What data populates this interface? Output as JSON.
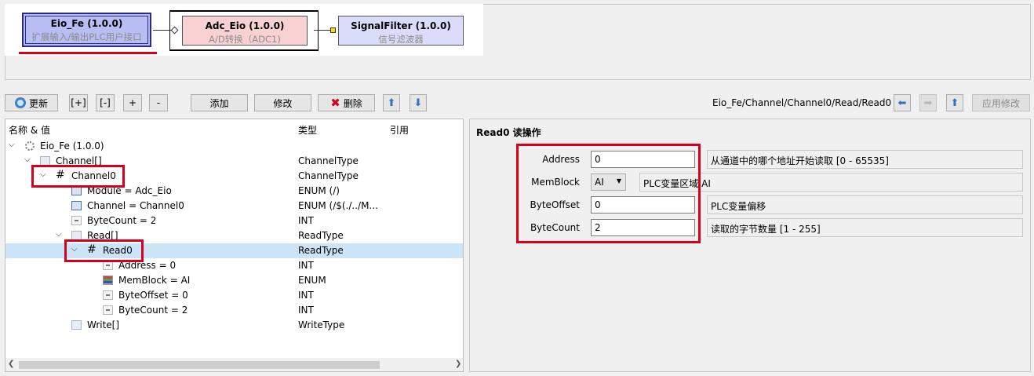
{
  "diagram": {
    "blocks": [
      {
        "title": "Eio_Fe (1.0.0)",
        "subtitle": "扩展输入/输出PLC用户接口"
      },
      {
        "title": "Adc_Eio (1.0.0)",
        "subtitle": "A/D转换（ADC1)"
      },
      {
        "title": "SignalFilter (1.0.0)",
        "subtitle": "信号滤波器"
      }
    ]
  },
  "toolbar": {
    "refresh": "更新",
    "expand": "[+]",
    "collapse": "[-]",
    "plus": "+",
    "minus": "-",
    "add": "添加",
    "modify": "修改",
    "delete": "删除",
    "path": "Eio_Fe/Channel/Channel0/Read/Read0",
    "apply": "应用修改",
    "icons": {
      "up": "arrow-up-icon",
      "down": "arrow-down-icon",
      "back": "arrow-left-icon",
      "forward": "arrow-right-icon"
    }
  },
  "tree": {
    "headers": {
      "name": "名称 & 值",
      "type": "类型",
      "ref": "引用"
    },
    "rows": [
      {
        "label": "Eio_Fe (1.0.0)",
        "type": ""
      },
      {
        "label": "Channel[]",
        "type": "ChannelType"
      },
      {
        "label": "Channel0",
        "type": "ChannelType"
      },
      {
        "label": "Module = Adc_Eio",
        "type": "ENUM (/)"
      },
      {
        "label": "Channel = Channel0",
        "type": "ENUM (/$(./../M..."
      },
      {
        "label": "ByteCount = 2",
        "type": "INT"
      },
      {
        "label": "Read[]",
        "type": "ReadType"
      },
      {
        "label": "Read0",
        "type": "ReadType"
      },
      {
        "label": "Address = 0",
        "type": "INT"
      },
      {
        "label": "MemBlock = AI",
        "type": "ENUM"
      },
      {
        "label": "ByteOffset = 0",
        "type": "INT"
      },
      {
        "label": "ByteCount = 2",
        "type": "INT"
      },
      {
        "label": "Write[]",
        "type": "WriteType"
      }
    ],
    "hash": "#"
  },
  "props": {
    "title": "Read0 读操作",
    "fields": [
      {
        "label": "Address",
        "value": "0",
        "desc": "从通道中的哪个地址开始读取 [0 - 65535]"
      },
      {
        "label": "MemBlock",
        "value": "AI",
        "desc": "PLC变量区域 AI"
      },
      {
        "label": "ByteOffset",
        "value": "0",
        "desc": "PLC变量偏移"
      },
      {
        "label": "ByteCount",
        "value": "2",
        "desc": "读取的字节数量 [1 - 255]"
      }
    ]
  },
  "colors": {
    "highlight": "#d6001c",
    "selection": "#cce4f7",
    "accent": "#2c72c8"
  }
}
